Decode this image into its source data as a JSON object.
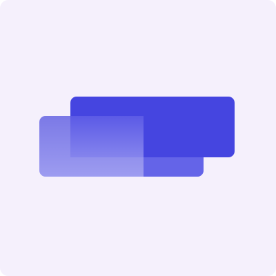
{
  "icon": {
    "semantic_name": "stacked-rectangles-logo",
    "colors": {
      "background": "#f5f0fc",
      "front_rectangle": "#4545e0",
      "back_rectangle_top": "#7b79e6",
      "back_rectangle_bottom": "#9d9cf0",
      "overlap_fade_top": "#5b5ae6",
      "overlap_fade_bottom": "#8584ed",
      "overlap_right": "#6464e8"
    }
  }
}
